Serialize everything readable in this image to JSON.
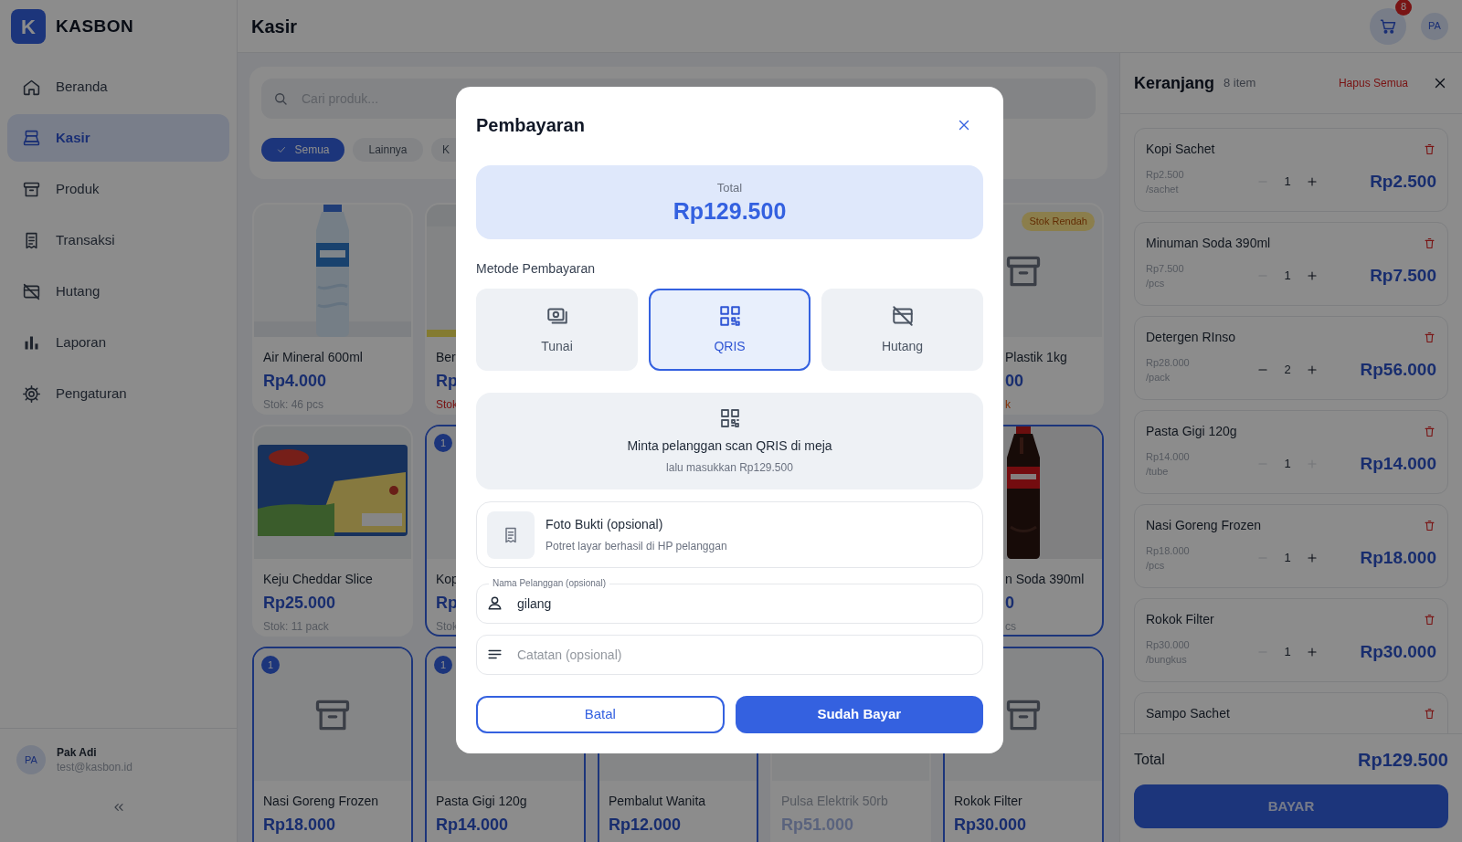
{
  "app": {
    "logo_letter": "K",
    "name": "KASBON"
  },
  "sidebar": {
    "items": [
      {
        "label": "Beranda",
        "selected": false
      },
      {
        "label": "Kasir",
        "selected": true
      },
      {
        "label": "Produk",
        "selected": false
      },
      {
        "label": "Transaksi",
        "selected": false
      },
      {
        "label": "Hutang",
        "selected": false
      },
      {
        "label": "Laporan",
        "selected": false
      },
      {
        "label": "Pengaturan",
        "selected": false
      }
    ],
    "user": {
      "initials": "PA",
      "name": "Pak Adi",
      "email": "test@kasbon.id"
    }
  },
  "header": {
    "title": "Kasir",
    "cart_count": "8",
    "avatar": "PA"
  },
  "search": {
    "placeholder": "Cari produk..."
  },
  "categories": [
    {
      "label": "Semua",
      "selected": true
    },
    {
      "label": "Lainnya",
      "selected": false
    },
    {
      "label": "K",
      "selected": false
    }
  ],
  "product_rows": [
    [
      {
        "kind": "bottle",
        "name": "Air Mineral 600ml",
        "price": "Rp4.000",
        "stock": "Stok: 46 pcs",
        "out_of_stock": false,
        "low_stock": false,
        "in_cart": false
      },
      {
        "kind": "pack",
        "name": "Ber",
        "price": "Rp",
        "stock": "Stok",
        "out_of_stock": true,
        "low_stock": false,
        "in_cart": false
      },
      null,
      null,
      {
        "kind": "box",
        "name": "Plastik 1kg",
        "price": "00",
        "stock": "k",
        "out_of_stock": false,
        "low_stock": true,
        "badge": "Stok Rendah",
        "covered_left": true,
        "in_cart": false
      }
    ],
    [
      {
        "kind": "cheese",
        "name": "Keju Cheddar Slice",
        "price": "Rp25.000",
        "stock": "Stok: 11 pack",
        "out_of_stock": false,
        "low_stock": false,
        "in_cart": false
      },
      {
        "kind": "covered",
        "name": "Kop",
        "price": "Rp",
        "stock": "Stok",
        "out_of_stock": false,
        "low_stock": false,
        "in_cart": true,
        "cart_badge": "1"
      },
      null,
      null,
      {
        "kind": "cola",
        "name": "n Soda 390ml",
        "price": "0",
        "stock": "cs",
        "out_of_stock": false,
        "low_stock": false,
        "covered_left": true,
        "in_cart": true
      }
    ],
    [
      {
        "kind": "box",
        "name": "Nasi Goreng Frozen",
        "price": "Rp18.000",
        "in_cart": true,
        "cart_badge": "1"
      },
      {
        "kind": "covered",
        "name": "Pasta Gigi 120g",
        "price": "Rp14.000",
        "in_cart": true,
        "cart_badge": "1"
      },
      {
        "kind": "covered",
        "name": "Pembalut Wanita",
        "price": "Rp12.000",
        "in_cart": true
      },
      {
        "kind": "covered",
        "name": "Pulsa Elektrik 50rb",
        "price": "Rp51.000",
        "in_cart": false,
        "disabled": true
      },
      {
        "kind": "box",
        "name": "Rokok Filter",
        "price": "Rp30.000",
        "in_cart": true
      }
    ]
  ],
  "cart": {
    "title": "Keranjang",
    "count": "8 item",
    "clear": "Hapus Semua",
    "items": [
      {
        "name": "Kopi Sachet",
        "price": "Rp2.500",
        "unit": "/sachet",
        "qty": "1",
        "subtotal": "Rp2.500",
        "minus_disabled": true,
        "plus_disabled": false
      },
      {
        "name": "Minuman Soda 390ml",
        "price": "Rp7.500",
        "unit": "/pcs",
        "qty": "1",
        "subtotal": "Rp7.500",
        "minus_disabled": true,
        "plus_disabled": false
      },
      {
        "name": "Detergen RInso",
        "price": "Rp28.000",
        "unit": "/pack",
        "qty": "2",
        "subtotal": "Rp56.000",
        "minus_disabled": false,
        "plus_disabled": false
      },
      {
        "name": "Pasta Gigi 120g",
        "price": "Rp14.000",
        "unit": "/tube",
        "qty": "1",
        "subtotal": "Rp14.000",
        "minus_disabled": true,
        "plus_disabled": true
      },
      {
        "name": "Nasi Goreng Frozen",
        "price": "Rp18.000",
        "unit": "/pcs",
        "qty": "1",
        "subtotal": "Rp18.000",
        "minus_disabled": true,
        "plus_disabled": false
      },
      {
        "name": "Rokok Filter",
        "price": "Rp30.000",
        "unit": "/bungkus",
        "qty": "1",
        "subtotal": "Rp30.000",
        "minus_disabled": true,
        "plus_disabled": false
      },
      {
        "name": "Sampo Sachet"
      }
    ],
    "total_label": "Total",
    "total": "Rp129.500",
    "pay": "BAYAR"
  },
  "payment_dialog": {
    "title": "Pembayaran",
    "total_label": "Total",
    "total": "Rp129.500",
    "method_label": "Metode Pembayaran",
    "methods": [
      {
        "label": "Tunai",
        "selected": false
      },
      {
        "label": "QRIS",
        "selected": true
      },
      {
        "label": "Hutang",
        "selected": false
      }
    ],
    "instruction": "Minta pelanggan scan QRIS di meja",
    "instruction_sub": "lalu masukkan Rp129.500",
    "proof_title": "Foto Bukti (opsional)",
    "proof_sub": "Potret layar berhasil di HP pelanggan",
    "name_field": {
      "label": "Nama Pelanggan (opsional)",
      "value": "gilang"
    },
    "note_field": {
      "placeholder": "Catatan (opsional)"
    },
    "cancel": "Batal",
    "confirm": "Sudah Bayar"
  }
}
